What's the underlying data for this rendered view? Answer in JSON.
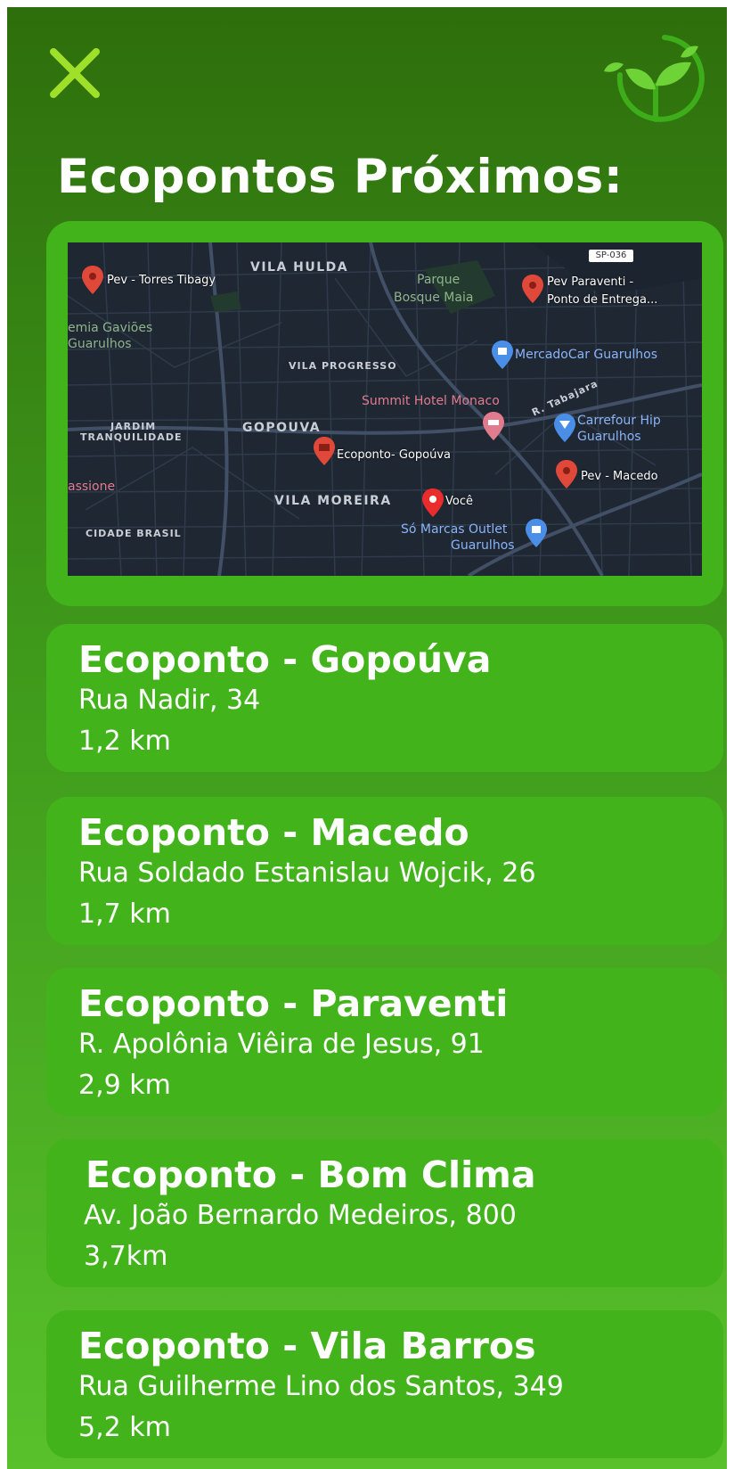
{
  "header": {
    "close_icon": "close-x-icon",
    "logo_icon": "leaf-sprout-logo-icon",
    "title": "Ecopontos Próximos:"
  },
  "map": {
    "areas": [
      "VILA HULDA",
      "VILA PROGRESSO",
      "GOPOUVA",
      "VILA MOREIRA",
      "JARDIM",
      "TRANQUILIDADE",
      "CIDADE BRASIL"
    ],
    "places": {
      "pev_torres": "Pev - Torres Tibagy",
      "parque_1": "Parque",
      "parque_2": "Bosque Maia",
      "pev_paraventi_1": "Pev Paraventi -",
      "pev_paraventi_2": "Ponto de Entrega...",
      "academia_1": "emia Gaviões",
      "academia_2": "Guarulhos",
      "mercadocar": "MercadoCar Guarulhos",
      "summit": "Summit Hotel Monaco",
      "tabajara": "R. Tabajara",
      "carrefour_1": "Carrefour Hip",
      "carrefour_2": "Guarulhos",
      "ecoponto_gopouva": "Ecoponto- Gopoúva",
      "pev_macedo": "Pev - Macedo",
      "voce": "Você",
      "assione": "assione",
      "so_marcas_1": "Só Marcas Outlet",
      "so_marcas_2": "Guarulhos",
      "road_badge": "SP-036"
    }
  },
  "ecopontos": [
    {
      "name": "Ecoponto - Gopoúva",
      "address": "Rua Nadir, 34",
      "distance": "1,2 km"
    },
    {
      "name": "Ecoponto - Macedo",
      "address": "Rua Soldado Estanislau Wojcik, 26",
      "distance": "1,7 km"
    },
    {
      "name": "Ecoponto - Paraventi",
      "address": "R. Apolônia Viêira de Jesus, 91",
      "distance": "2,9 km"
    },
    {
      "name": "Ecoponto - Bom Clima",
      "address": "Av. João Bernardo Medeiros, 800",
      "distance": "3,7km"
    },
    {
      "name": "Ecoponto - Vila Barros",
      "address": "Rua Guilherme Lino dos Santos, 349",
      "distance": "5,2 km"
    }
  ],
  "colors": {
    "accent_green": "#43b31c",
    "background_top": "#2e6e0c",
    "background_bottom": "#58c12b",
    "close_icon": "#9ee02a",
    "pin_red": "#e0483a",
    "pin_blue": "#4a8ee8",
    "map_bg": "#1f2733"
  }
}
